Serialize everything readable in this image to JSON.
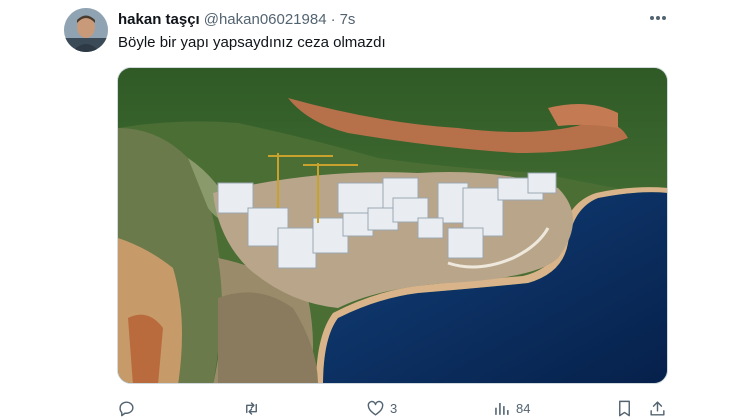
{
  "author": {
    "name": "hakan taşçı",
    "handle": "@hakan06021984",
    "separator": "·",
    "time": "7s"
  },
  "tweet": {
    "text": "Böyle bir yapı yapsaydınız ceza olmazdı"
  },
  "actions": {
    "reply_count": "",
    "retweet_count": "",
    "like_count": "3",
    "views_count": "84"
  },
  "icons": {
    "more": "more-horizontal-icon",
    "reply": "reply-icon",
    "retweet": "retweet-icon",
    "like": "heart-icon",
    "views": "views-chart-icon",
    "bookmark": "bookmark-icon",
    "share": "share-icon"
  },
  "colors": {
    "text_primary": "#0f1419",
    "text_secondary": "#536471",
    "border": "#cfd9de",
    "sea": "#0a2a5e"
  }
}
